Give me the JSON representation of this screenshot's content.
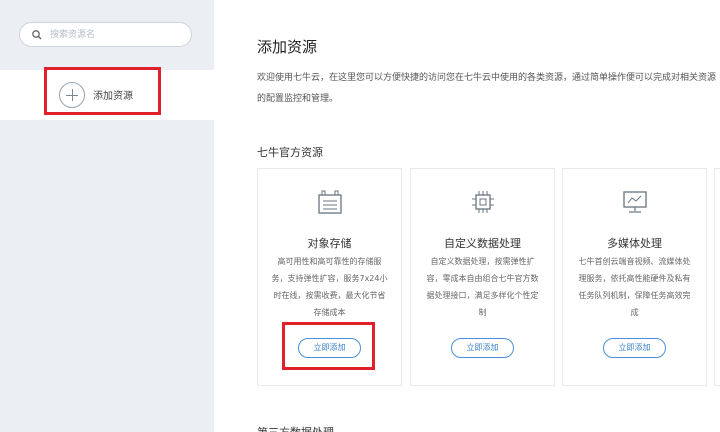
{
  "sidebar": {
    "search": {
      "placeholder": "搜索资源名"
    },
    "add_item": {
      "label": "添加资源"
    }
  },
  "main": {
    "title": "添加资源",
    "description": "欢迎使用七牛云，在这里您可以方便快捷的访问您在七牛云中使用的各类资源，通过简单操作便可以完成对相关资源的配置监控和管理。",
    "section_official": "七牛官方资源",
    "section_third": "第三方数据处理",
    "cards": [
      {
        "name": "对象存储",
        "icon": "object-storage-icon",
        "text": "高可用性和高可靠性的存储服务，支持弹性扩容，服务7x24小时在线，按需收费，最大化节省存储成本",
        "button": "立即添加"
      },
      {
        "name": "自定义数据处理",
        "icon": "chip-icon",
        "text": "自定义数据处理，按需弹性扩容，零成本自由组合七牛官方数据处理接口，满足多样化个性定制",
        "button": "立即添加"
      },
      {
        "name": "多媒体处理",
        "icon": "monitor-icon",
        "text": "七牛首创云端音视频、流媒体处理服务，依托高性能硬件及私有任务队列机制，保障任务高效完成",
        "button": "立即添加"
      }
    ]
  },
  "colors": {
    "highlight": "#e0202a",
    "accent": "#3b82c8",
    "sidebar_bg": "#ebeef2"
  }
}
